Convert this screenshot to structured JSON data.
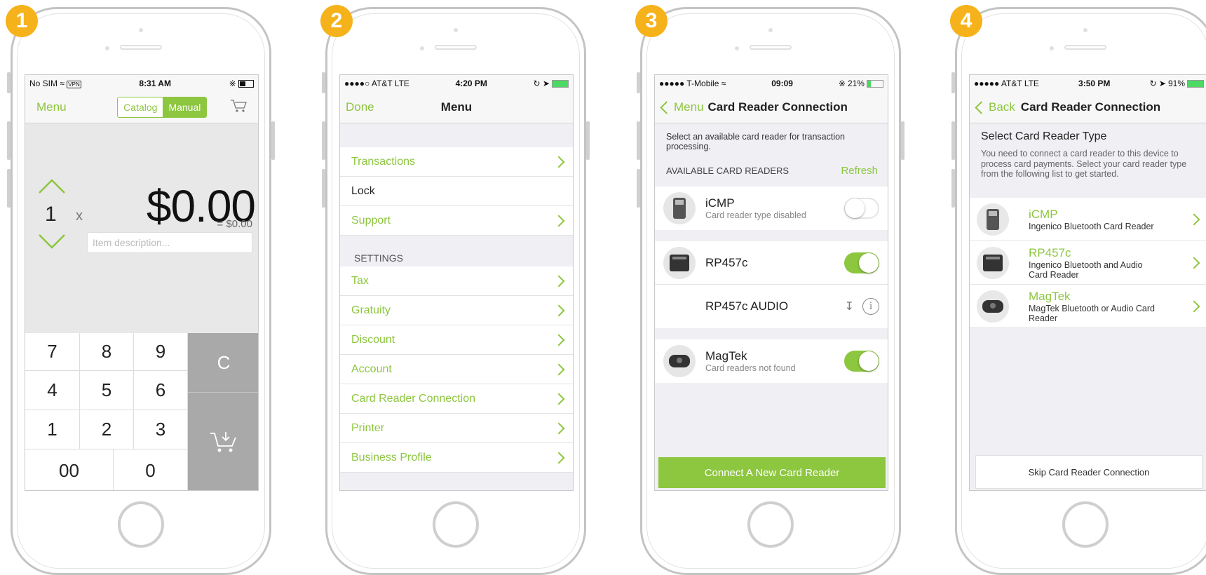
{
  "steps": [
    "1",
    "2",
    "3",
    "4"
  ],
  "accent": "#8dc63f",
  "badge_color": "#f6b21a",
  "screen1": {
    "status": {
      "left": "No SIM",
      "vpn": "VPN",
      "time": "8:31 AM"
    },
    "nav": {
      "menu": "Menu",
      "tabs": [
        "Catalog",
        "Manual"
      ],
      "selected_tab": "Manual"
    },
    "quantity": "1",
    "times": "x",
    "amount": "$0.00",
    "subtotal": "= $0.00",
    "description_placeholder": "Item description...",
    "keys": [
      "7",
      "8",
      "9",
      "4",
      "5",
      "6",
      "1",
      "2",
      "3",
      "00",
      "0"
    ],
    "clear_key": "C"
  },
  "screen2": {
    "status": {
      "left": "AT&T  LTE",
      "time": "4:20 PM"
    },
    "nav": {
      "done": "Done",
      "title": "Menu"
    },
    "items_top": [
      {
        "label": "Transactions",
        "link": true
      },
      {
        "label": "Lock",
        "link": false
      },
      {
        "label": "Support",
        "link": true
      }
    ],
    "settings_label": "SETTINGS",
    "items_settings": [
      "Tax",
      "Gratuity",
      "Discount",
      "Account",
      "Card Reader Connection",
      "Printer",
      "Business Profile"
    ]
  },
  "screen3": {
    "status": {
      "left": "T-Mobile",
      "time": "09:09",
      "battery": "21%"
    },
    "nav": {
      "back": "Menu",
      "title": "Card Reader Connection"
    },
    "intro": "Select an available card reader for transaction processing.",
    "section_label": "AVAILABLE CARD READERS",
    "refresh": "Refresh",
    "readers": {
      "icmp": {
        "name": "iCMP",
        "status": "Card reader type disabled",
        "enabled": false
      },
      "rp457c": {
        "name": "RP457c",
        "enabled": true
      },
      "rp457c_audio": {
        "name": "RP457c AUDIO"
      },
      "magtek": {
        "name": "MagTek",
        "status": "Card readers not found",
        "enabled": true
      }
    },
    "connect_button": "Connect A New Card Reader"
  },
  "screen4": {
    "status": {
      "left": "AT&T  LTE",
      "time": "3:50 PM",
      "battery": "91%"
    },
    "nav": {
      "back": "Back",
      "title": "Card Reader Connection"
    },
    "heading": "Select Card Reader Type",
    "description": "You need to connect a card reader to this device to process card payments. Select your card reader type from the following list to get started.",
    "readers": [
      {
        "name": "iCMP",
        "desc": "Ingenico Bluetooth Card Reader"
      },
      {
        "name": "RP457c",
        "desc": "Ingenico Bluetooth and Audio Card Reader"
      },
      {
        "name": "MagTek",
        "desc": "MagTek Bluetooth or Audio Card Reader"
      }
    ],
    "skip_button": "Skip Card Reader Connection"
  }
}
